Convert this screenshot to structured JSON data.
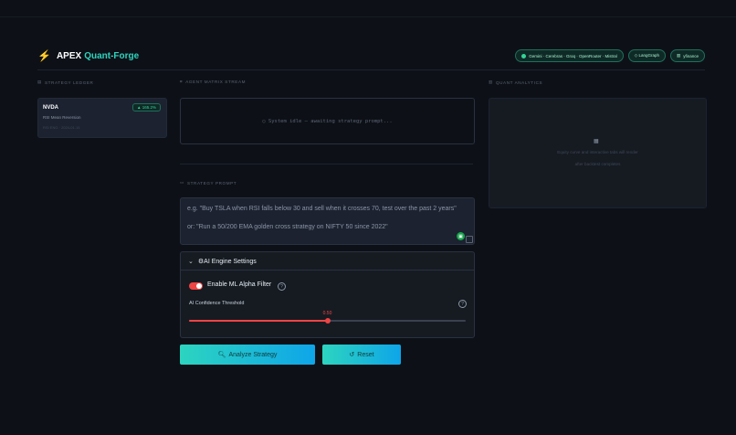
{
  "header": {
    "logo_icon": "bolt-icon",
    "title": "APEX",
    "title_accent": "Quant-Forge",
    "badges": [
      {
        "label": "Gemini · Cerebras · Groq · OpenRouter · Mistral"
      },
      {
        "label": "◇ LangGraph"
      },
      {
        "label": "yfinance"
      }
    ]
  },
  "sections": {
    "ledger": "STRATEGY LEDGER",
    "stream": "AGENT MATRIX STREAM",
    "analytics": "QUANT ANALYTICS",
    "prompt": "STRATEGY PROMPT"
  },
  "ledger_card": {
    "ticker": "NVDA",
    "strategy": "RSI Mean Reversion",
    "pct": "▲ 165.2%",
    "meta": "RSI ENG · 2024-01-15"
  },
  "stream": {
    "status": "○ System idle — awaiting strategy prompt..."
  },
  "prompt": {
    "placeholder": "e.g. \"Buy TSLA when RSI falls below 30 and sell when it crosses 70, test over the past 2 years\"\n\nor: \"Run a 50/200 EMA golden cross strategy on NIFTY 50 since 2022\""
  },
  "settings": {
    "title": "AI Engine Settings",
    "toggle_label": "Enable ML Alpha Filter",
    "toggle_on": true,
    "threshold_label": "AI Confidence Threshold",
    "threshold_value": "0.50",
    "threshold_fraction": 0.5
  },
  "buttons": {
    "analyze": "Analyze Strategy",
    "reset": "Reset"
  },
  "analytics": {
    "line1": "Equity curve and interactive tabs will render",
    "line2": "after backtest completes"
  },
  "colors": {
    "accent": "#2dd4bf",
    "danger": "#ef4444",
    "positive": "#34d399"
  }
}
